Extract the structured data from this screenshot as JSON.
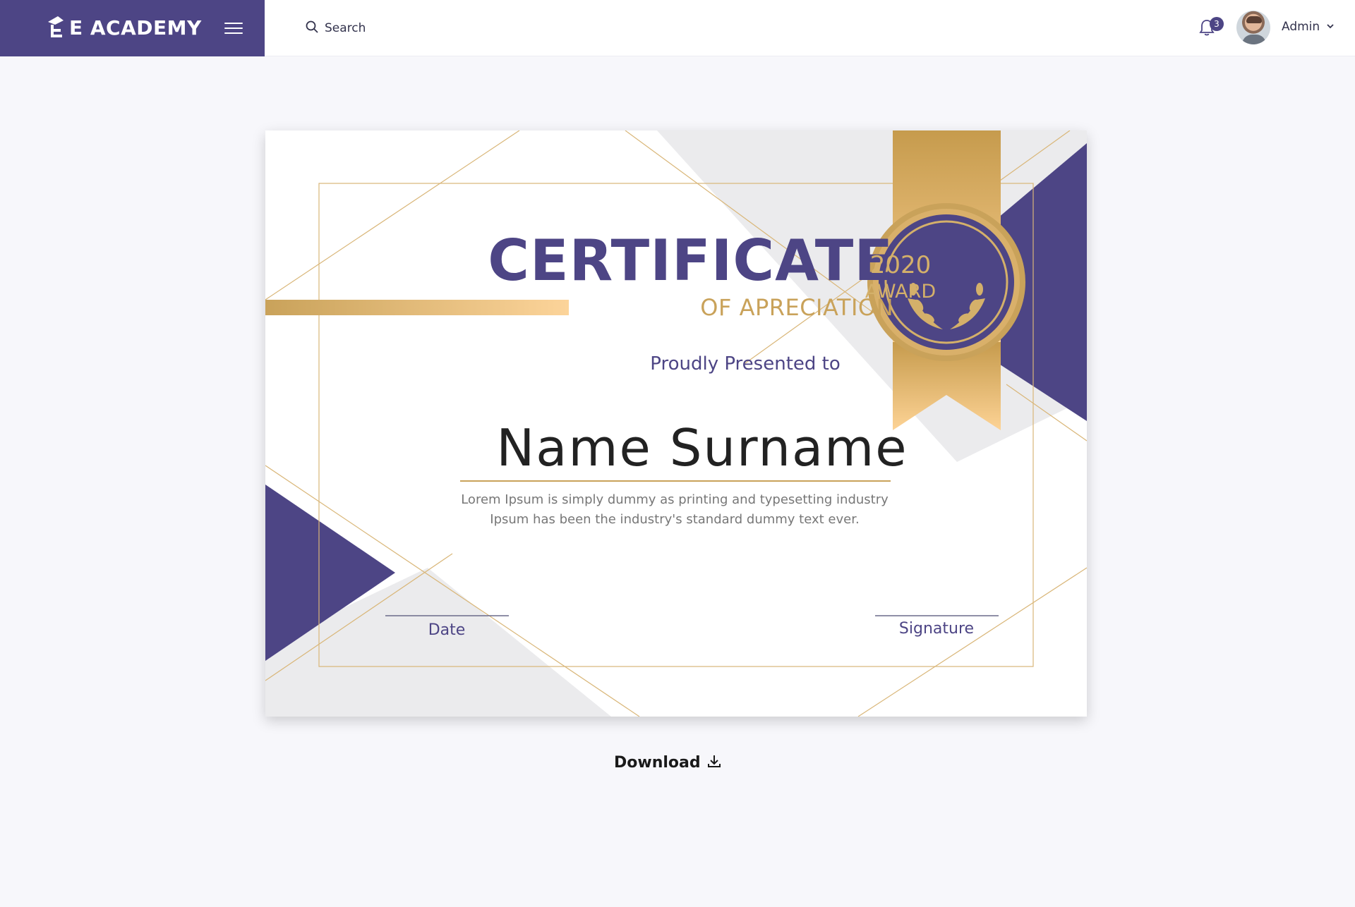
{
  "app": {
    "brand": "E ACADEMY"
  },
  "topbar": {
    "search_label": "Search",
    "notifications_count": "3",
    "user_name": "Admin"
  },
  "certificate": {
    "title": "CERTIFICATE",
    "subtitle": "OF APRECIATION",
    "presented": "Proudly Presented to",
    "name": "Name Surname",
    "lorem_line1": "Lorem Ipsum is simply dummy as printing and typesetting industry",
    "lorem_line2": "Ipsum has been the industry's standard dummy text ever.",
    "date_label": "Date",
    "signature_label": "Signature",
    "seal_year": "2020",
    "seal_award": "AWARD"
  },
  "actions": {
    "download_label": "Download"
  },
  "colors": {
    "primary": "#4d4585",
    "gold": "#c9a25a",
    "background": "#f7f7fb"
  },
  "icons": [
    "menu-icon",
    "search-icon",
    "bell-icon",
    "chevron-down-icon",
    "download-icon",
    "logo-icon"
  ]
}
